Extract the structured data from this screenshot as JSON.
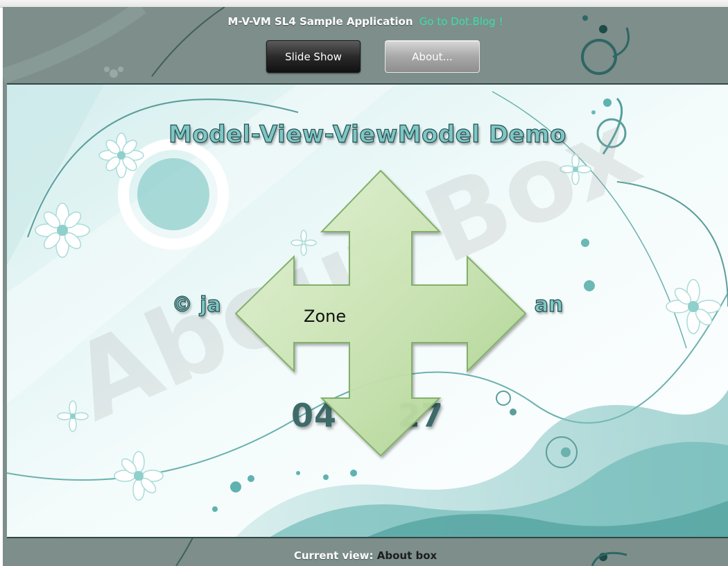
{
  "header": {
    "title": "M-V-VM SL4 Sample Application",
    "blog_link": "Go to Dot.Blog !",
    "buttons": {
      "slideshow": "Slide Show",
      "about": "About..."
    }
  },
  "about_view": {
    "title": "Model-View-ViewModel Demo",
    "author_left": "© ja",
    "author_right": "an",
    "clock_left": "04",
    "clock_right": "27",
    "watermark": "About Box"
  },
  "overlay": {
    "label": "Zone"
  },
  "footer": {
    "status_label": "Current view:",
    "current_view": "About box"
  },
  "colors": {
    "frame": "#7d8e8b",
    "accent_link": "#38e0a8",
    "title_fill": "#7fc6c4",
    "arrow_fill": "#c8e2b0"
  },
  "icons": {
    "overlay": "four-way-move-arrow-icon"
  }
}
